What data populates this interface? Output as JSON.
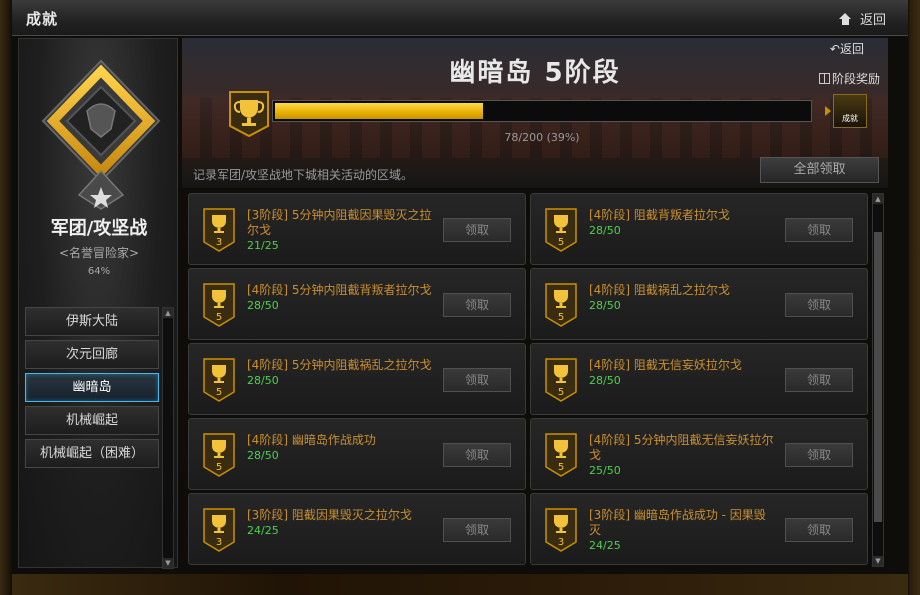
{
  "window": {
    "title": "成就",
    "back_label": "返回"
  },
  "sidebar": {
    "category_title": "军团/攻坚战",
    "rank": "<名誉冒险家>",
    "percent": "64%",
    "items": [
      {
        "label": "伊斯大陆",
        "active": false
      },
      {
        "label": "次元回廊",
        "active": false
      },
      {
        "label": "幽暗岛",
        "active": true
      },
      {
        "label": "机械崛起",
        "active": false
      },
      {
        "label": "机械崛起（困难）",
        "active": false
      }
    ]
  },
  "header": {
    "stage_title": "幽暗岛 5阶段",
    "back_label": "返回",
    "stage_reward_label": "阶段奖励",
    "progress_text": "78/200 (39%)",
    "progress_fraction": 0.39,
    "chest_label": "成就"
  },
  "description": "记录军团/攻坚战地下城相关活动的区域。",
  "claim_all_label": "全部领取",
  "achievements": [
    {
      "text": "[3阶段] 5分钟内阻截因果毁灭之拉尔戈",
      "stage": "3",
      "progress": "21/25",
      "claim": "领取"
    },
    {
      "text": "[4阶段] 阻截背叛者拉尔戈",
      "stage": "5",
      "progress": "28/50",
      "claim": "领取"
    },
    {
      "text": "[4阶段] 5分钟内阻截背叛者拉尔戈",
      "stage": "5",
      "progress": "28/50",
      "claim": "领取"
    },
    {
      "text": "[4阶段] 阻截祸乱之拉尔戈",
      "stage": "5",
      "progress": "28/50",
      "claim": "领取"
    },
    {
      "text": "[4阶段] 5分钟内阻截祸乱之拉尔戈",
      "stage": "5",
      "progress": "28/50",
      "claim": "领取"
    },
    {
      "text": "[4阶段] 阻截无信妄妖拉尔戈",
      "stage": "5",
      "progress": "28/50",
      "claim": "领取"
    },
    {
      "text": "[4阶段] 幽暗岛作战成功",
      "stage": "5",
      "progress": "28/50",
      "claim": "领取"
    },
    {
      "text": "[4阶段] 5分钟内阻截无信妄妖拉尔戈",
      "stage": "5",
      "progress": "25/50",
      "claim": "领取"
    },
    {
      "text": "[3阶段] 阻截因果毁灭之拉尔戈",
      "stage": "3",
      "progress": "24/25",
      "claim": "领取"
    },
    {
      "text": "[3阶段] 幽暗岛作战成功 - 因果毁灭",
      "stage": "3",
      "progress": "24/25",
      "claim": "领取"
    }
  ],
  "colors": {
    "accent_gold": "#e5b000",
    "progress_green": "#4fd04f",
    "active_border": "#49b8e8",
    "achievement_text": "#c98f2f"
  },
  "icons": {
    "home": "home-icon",
    "back": "back-arrow-icon",
    "gift": "gift-icon",
    "trophy": "trophy-icon",
    "emblem": "guild-emblem-icon",
    "chest": "treasure-chest-icon"
  }
}
